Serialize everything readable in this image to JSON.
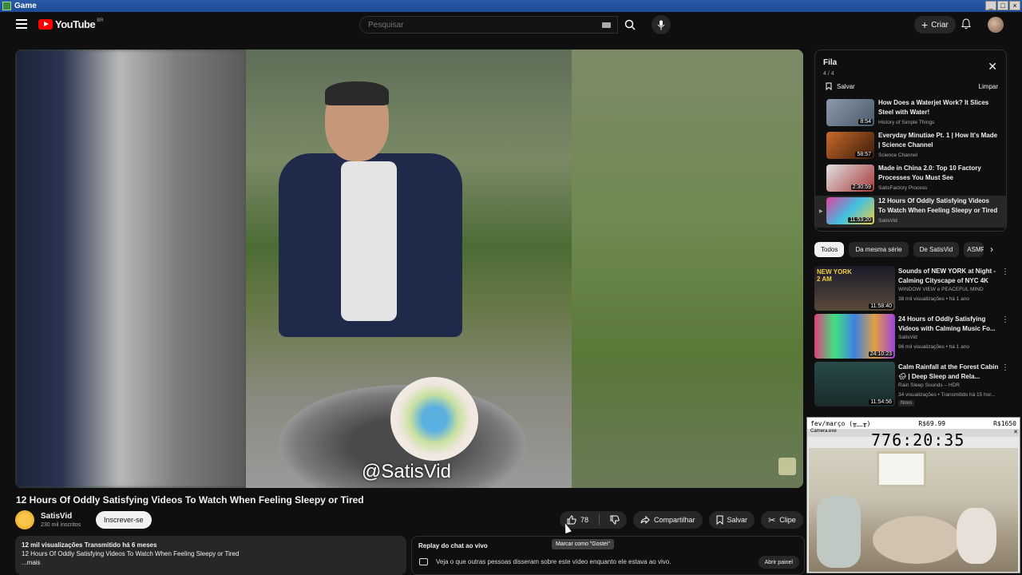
{
  "window": {
    "title": "Game"
  },
  "header": {
    "logo_text": "YouTube",
    "country": "BR",
    "search_placeholder": "Pesquisar",
    "create_label": "Criar"
  },
  "video": {
    "watermark": "@SatisVid",
    "title": "12 Hours Of Oddly Satisfying Videos To Watch When Feeling Sleepy or Tired",
    "channel": "SatisVid",
    "subscribers": "230 mil inscritos",
    "subscribe_label": "Inscrever-se",
    "likes": "78",
    "share_label": "Compartilhar",
    "save_label": "Salvar",
    "clip_label": "Clipe",
    "tooltip": "Marcar como \"Gostei\""
  },
  "description": {
    "stats": "12 mil visualizações  Transmitido há 6 meses",
    "line": "12 Hours Of Oddly Satisfying Videos To Watch When Feeling Sleepy or Tired",
    "more": "...mais"
  },
  "chat_replay": {
    "header": "Replay do chat ao vivo",
    "message": "Veja o que outras pessoas disseram sobre este vídeo enquanto ele estava ao vivo.",
    "open_label": "Abrir painel"
  },
  "queue": {
    "title": "Fila",
    "count": "4 / 4",
    "save_label": "Salvar",
    "clear_label": "Limpar",
    "items": [
      {
        "title": "How Does a Waterjet Work? It Slices Steel with Water!",
        "channel": "History of Simple Things",
        "duration": "8:54",
        "color": "#6a7a8a"
      },
      {
        "title": "Everyday Minutiae Pt. 1 | How It's Made | Science Channel",
        "channel": "Science Channel",
        "duration": "58:57",
        "color": "#7a3a1a"
      },
      {
        "title": "Made in China 2.0: Top 10 Factory Processes You Must See",
        "channel": "SatisFactory Process",
        "duration": "2:30:59",
        "color": "#8a3a3a"
      },
      {
        "title": "12 Hours Of Oddly Satisfying Videos To Watch When Feeling Sleepy or Tired",
        "channel": "SatisVid",
        "duration": "11:53:20",
        "color": "#4a7ab0",
        "playing": "▶"
      }
    ]
  },
  "chips": [
    "Todos",
    "Da mesma série",
    "De SatisVid",
    "ASMR"
  ],
  "recommendations": [
    {
      "title": "Sounds of NEW YORK at Night - Calming Cityscape of NYC 4K",
      "channel": "WINDOW VIEW e PEACEFUL MIND",
      "meta": "38 mil visualizações • há 1 ano",
      "duration": "11:58:40",
      "thumb_text": "NEW YORK 2 AM",
      "color": "#2a2a3a"
    },
    {
      "title": "24 Hours of Oddly Satisfying Videos with Calming Music Fo...",
      "channel": "SatisVid",
      "meta": "96 mil visualizações • há 1 ano",
      "duration": "24:10:23",
      "color": "#5a3a6a"
    },
    {
      "title": "Calm Rainfall at the Forest Cabin 🌧 | Deep Sleep and Rela...",
      "channel": "Rain Sleep Sounds – HDR",
      "meta": "34 visualizações • Transmitido há 15 hor...",
      "duration": "11:54:56",
      "badge": "Novo",
      "color": "#2a3a3a"
    }
  ],
  "overlay": {
    "top_left": "fev/março (╥﹏╥)",
    "top_mid": "R$69.99",
    "top_right": "R$1650",
    "window_title": "Camera.exe",
    "timer": "776:20:35"
  }
}
